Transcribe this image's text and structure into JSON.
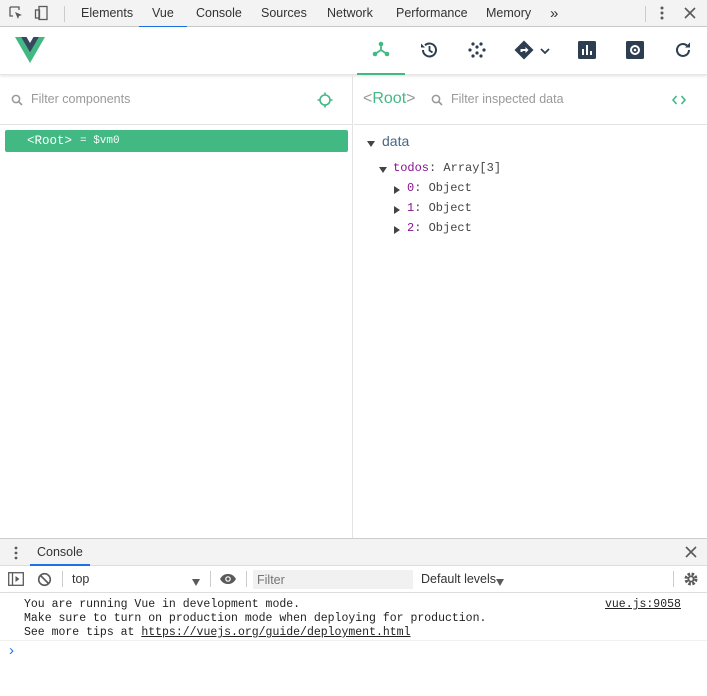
{
  "devtools": {
    "tabs": [
      "Elements",
      "Vue",
      "Console",
      "Sources",
      "Network",
      "Performance",
      "Memory"
    ],
    "active_tab": "Vue",
    "more_tabs_label": "»"
  },
  "vue": {
    "accent": "#42b983",
    "header_buttons": [
      "components-icon",
      "history-icon",
      "vuex-icon",
      "routing-icon",
      "performance-icon",
      "settings-icon",
      "refresh-icon"
    ]
  },
  "components": {
    "filter_placeholder": "Filter components",
    "root_label": "<Root>",
    "root_vm": "= $vm0"
  },
  "inspector": {
    "title_open": "<",
    "title_name": "Root",
    "title_close": ">",
    "filter_placeholder": "Filter inspected data",
    "section": "data",
    "todos_key": "todos",
    "todos_value": "Array[3]",
    "items": [
      {
        "key": "0",
        "value": "Object"
      },
      {
        "key": "1",
        "value": "Object"
      },
      {
        "key": "2",
        "value": "Object"
      }
    ]
  },
  "console": {
    "drawer_tab": "Console",
    "context": "top",
    "filter_placeholder": "Filter",
    "levels": "Default levels",
    "messages": [
      "You are running Vue in development mode.",
      "Make sure to turn on production mode when deploying for production.",
      "See more tips at "
    ],
    "tips_link": "https://vuejs.org/guide/deployment.html",
    "source": "vue.js:9058",
    "prompt": "›"
  }
}
